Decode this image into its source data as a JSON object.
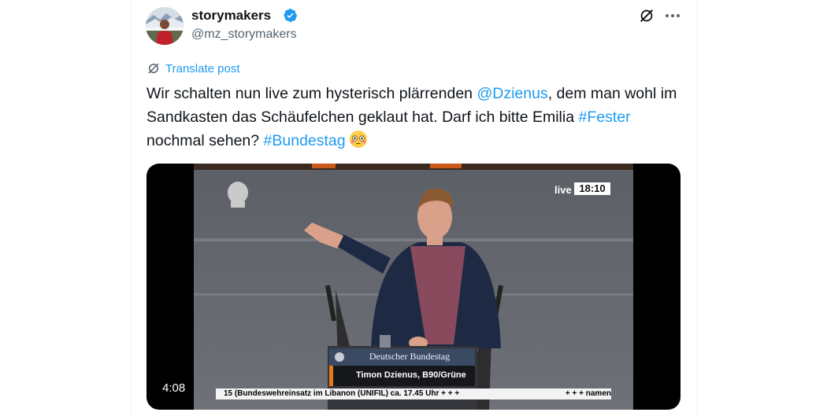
{
  "author": {
    "display_name": "storymakers",
    "handle": "@mz_storymakers"
  },
  "translate": {
    "label": "Translate post"
  },
  "post": {
    "text_1": "Wir schalten nun live zum hysterisch plärrenden ",
    "mention": "@Dzienus",
    "text_2": ", dem man wohl im Sandkasten das Schäufelchen geklaut hat. Darf ich bitte Emilia ",
    "hashtag_1": "#Fester",
    "text_3": " nochmal sehen? ",
    "hashtag_2": "#Bundestag",
    "emoji": "flushed-face-emoji"
  },
  "video": {
    "duration": "4:08",
    "overlay": {
      "live": "live",
      "clock": "18:10",
      "org": "Deutscher Bundestag",
      "speaker": "Timon Dzienus, B90/Grüne",
      "ticker": "15 (Bundeswehreinsatz im Libanon (UNIFIL) ca. 17.45 Uhr   + + +",
      "ticker_right": "+ + +  namen"
    }
  },
  "colors": {
    "accent": "#1d9bf0",
    "text": "#0f1419",
    "secondary": "#536471"
  }
}
